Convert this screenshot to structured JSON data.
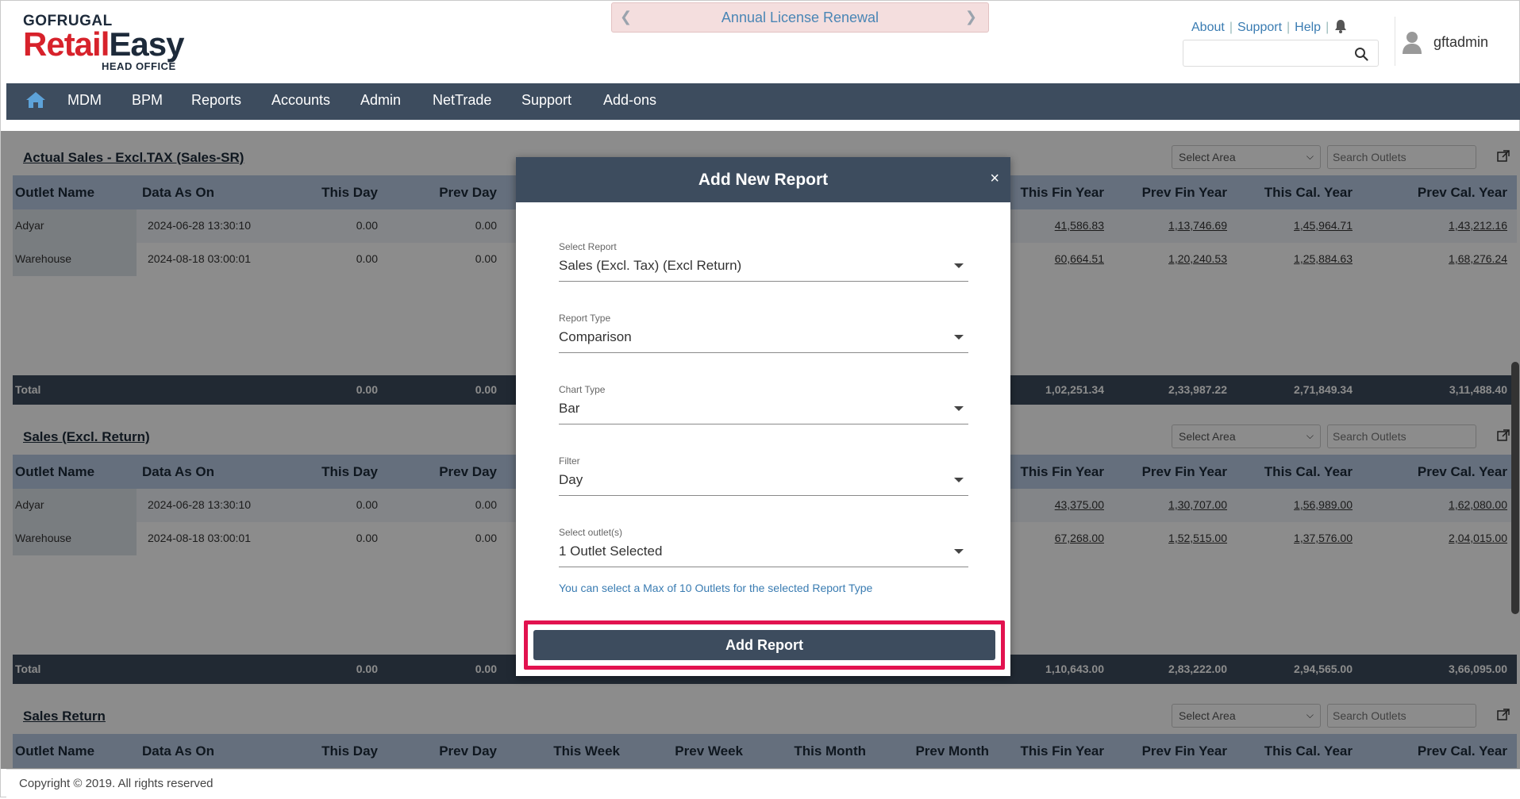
{
  "logo": {
    "line1": "GOFRUGAL",
    "line2a": "Retail",
    "line2b": "Easy",
    "line3": "HEAD OFFICE"
  },
  "banner": {
    "text": "Annual License Renewal"
  },
  "toplinks": [
    "About",
    "Support",
    "Help"
  ],
  "search": {
    "value": "",
    "placeholder": ""
  },
  "user": {
    "name": "gftadmin"
  },
  "nav": [
    "MDM",
    "BPM",
    "Reports",
    "Accounts",
    "Admin",
    "NetTrade",
    "Support",
    "Add-ons"
  ],
  "panels": [
    {
      "title": "Actual Sales - Excl.TAX (Sales-SR)",
      "area": "Select Area",
      "search_placeholder": "Search Outlets",
      "rows": [
        {
          "name": "Adyar",
          "date": "2024-06-28 13:30:10",
          "this_day": "0.00",
          "prev_day": "0.00",
          "this_fin": "41,586.83",
          "prev_fin": "1,13,746.69",
          "this_cal": "1,45,964.71",
          "prev_cal": "1,43,212.16"
        },
        {
          "name": "Warehouse",
          "date": "2024-08-18 03:00:01",
          "this_day": "0.00",
          "prev_day": "0.00",
          "this_fin": "60,664.51",
          "prev_fin": "1,20,240.53",
          "this_cal": "1,25,884.63",
          "prev_cal": "1,68,276.24"
        }
      ],
      "total": {
        "label": "Total",
        "this_day": "0.00",
        "prev_day": "0.00",
        "this_fin": "1,02,251.34",
        "prev_fin": "2,33,987.22",
        "this_cal": "2,71,849.34",
        "prev_cal": "3,11,488.40"
      }
    },
    {
      "title": "Sales (Excl. Return)",
      "area": "Select Area",
      "search_placeholder": "Search Outlets",
      "rows": [
        {
          "name": "Adyar",
          "date": "2024-06-28 13:30:10",
          "this_day": "0.00",
          "prev_day": "0.00",
          "this_fin": "43,375.00",
          "prev_fin": "1,30,707.00",
          "this_cal": "1,56,989.00",
          "prev_cal": "1,62,080.00"
        },
        {
          "name": "Warehouse",
          "date": "2024-08-18 03:00:01",
          "this_day": "0.00",
          "prev_day": "0.00",
          "this_fin": "67,268.00",
          "prev_fin": "1,52,515.00",
          "this_cal": "1,37,576.00",
          "prev_cal": "2,04,015.00"
        }
      ],
      "total": {
        "label": "Total",
        "this_day": "0.00",
        "prev_day": "0.00",
        "this_fin": "1,10,643.00",
        "prev_fin": "2,83,222.00",
        "this_cal": "2,94,565.00",
        "prev_cal": "3,66,095.00"
      }
    },
    {
      "title": "Sales Return",
      "area": "Select Area",
      "search_placeholder": "Search Outlets"
    }
  ],
  "columns": {
    "outlet_name": "Outlet Name",
    "data_as_on": "Data As On",
    "this_day": "This Day",
    "prev_day": "Prev Day",
    "this_week": "This Week",
    "prev_week": "Prev Week",
    "this_month": "This Month",
    "prev_month": "Prev Month",
    "this_fin": "This Fin Year",
    "prev_fin": "Prev Fin Year",
    "this_cal": "This Cal. Year",
    "prev_cal": "Prev Cal. Year"
  },
  "footer": {
    "text": "Copyright © 2019. All rights reserved"
  },
  "modal": {
    "title": "Add New Report",
    "close": "×",
    "fields": [
      {
        "label": "Select Report",
        "value": "Sales (Excl. Tax) (Excl Return)"
      },
      {
        "label": "Report Type",
        "value": "Comparison"
      },
      {
        "label": "Chart Type",
        "value": "Bar"
      },
      {
        "label": "Filter",
        "value": "Day"
      },
      {
        "label": "Select outlet(s)",
        "value": "1 Outlet Selected"
      }
    ],
    "hint": "You can select a Max of 10 Outlets for the selected Report Type",
    "add_button": "Add Report"
  },
  "colors": {
    "nav_bg": "#3d4c5e",
    "brand_red": "#d7222b",
    "table_header": "#b9cbe4",
    "link": "#3a7cb2",
    "highlight": "#e2124f"
  }
}
